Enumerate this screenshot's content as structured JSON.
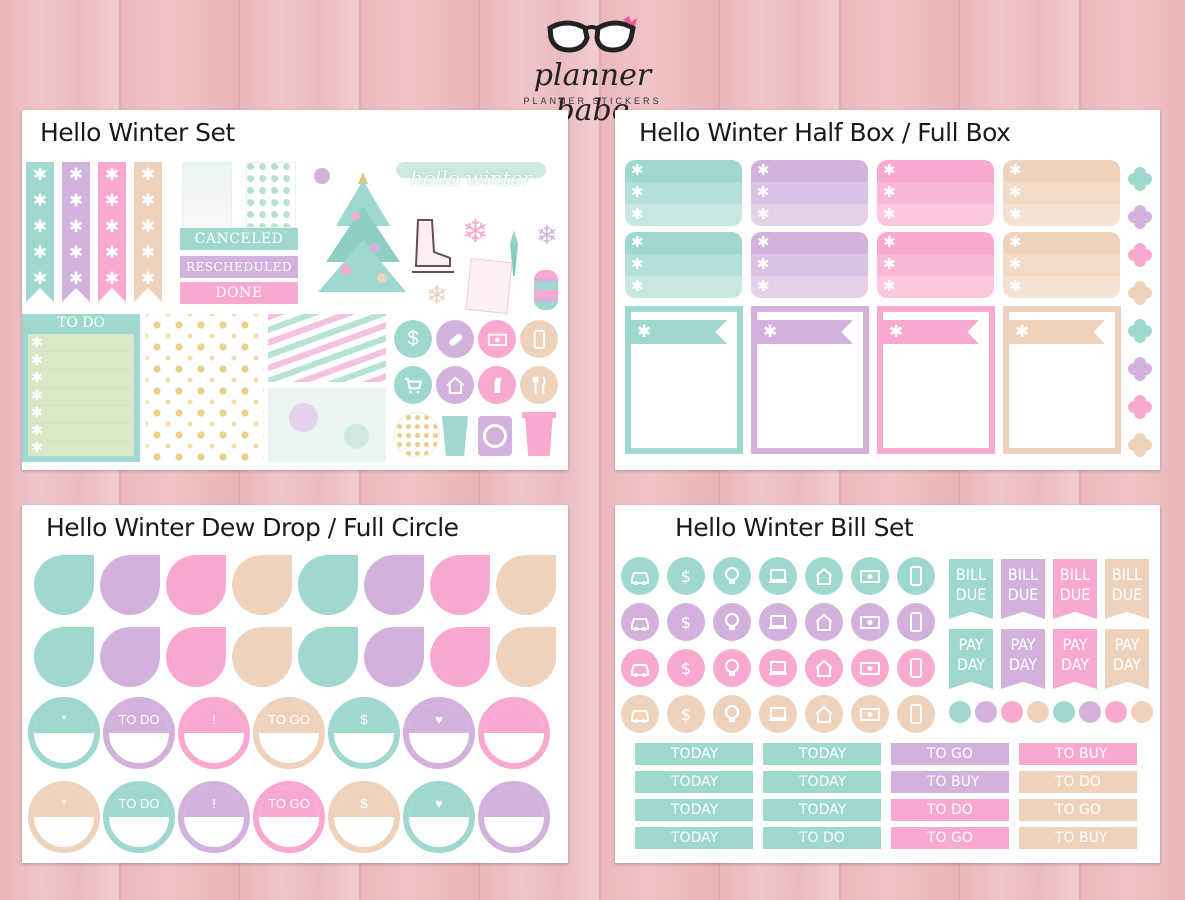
{
  "logo": {
    "brand": "planner babe",
    "sub": "PLANNER STICKERS"
  },
  "colors": {
    "teal": "#9fd8ce",
    "purple": "#d2b2dc",
    "pink": "#f9a8cf",
    "peach": "#efd2bb",
    "pinkbg": "#eab9be"
  },
  "sheets": {
    "set": {
      "title": "Hello Winter Set",
      "todo": "TO DO",
      "labels": [
        "CANCELED",
        "RESCHEDULED",
        "DONE"
      ]
    },
    "box": {
      "title": "Hello Winter Half Box / Full Box"
    },
    "dew": {
      "title": "Hello Winter Dew Drop / Full Circle",
      "row3": [
        "*",
        "TO DO",
        "!",
        "TO GO",
        "$",
        "♥",
        ""
      ],
      "row4": [
        "*",
        "TO DO",
        "!",
        "TO GO",
        "$",
        "♥",
        ""
      ]
    },
    "bill": {
      "title": "Hello Winter Bill Set",
      "bill_due": "BILL DUE",
      "pay_day": "PAY DAY",
      "strips": [
        [
          "TODAY",
          "TODAY",
          "TODAY",
          "TODAY"
        ],
        [
          "TODAY",
          "TODAY",
          "TODAY",
          "TO DO"
        ],
        [
          "TO GO",
          "TO BUY",
          "TO DO",
          "TO GO"
        ],
        [
          "TO BUY",
          "TO DO",
          "TO GO",
          "TO BUY"
        ]
      ]
    }
  },
  "deco_text": {
    "hello_winter": "hello winter"
  }
}
